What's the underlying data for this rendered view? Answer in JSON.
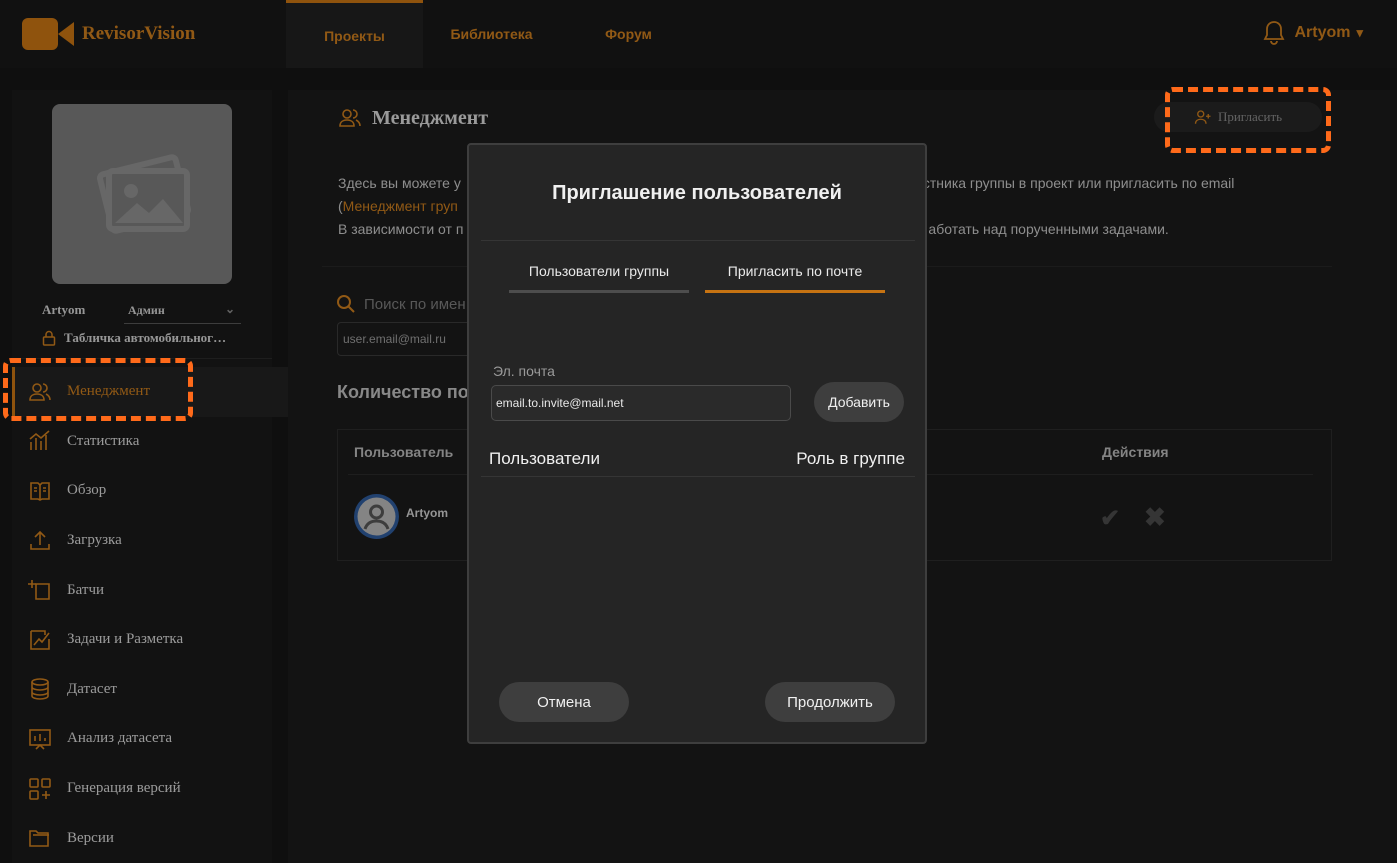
{
  "brand": {
    "name": "RevisorVision",
    "accent": "#c67312",
    "highlight": "#ff6a1a"
  },
  "nav": {
    "tabs": [
      {
        "label": "Проекты"
      },
      {
        "label": "Библиотека"
      },
      {
        "label": "Форум"
      }
    ]
  },
  "header": {
    "username": "Artyom",
    "caret": "▾"
  },
  "sidebar": {
    "user": "Artyom",
    "role": "Админ",
    "role_caret": "⌄",
    "project": "Табличка автомобильног…",
    "items": [
      {
        "label": "Менеджмент",
        "icon": "users-icon"
      },
      {
        "label": "Статистика",
        "icon": "stats-icon"
      },
      {
        "label": "Обзор",
        "icon": "book-icon"
      },
      {
        "label": "Загрузка",
        "icon": "upload-icon"
      },
      {
        "label": "Батчи",
        "icon": "batch-icon"
      },
      {
        "label": "Задачи и Разметка",
        "icon": "annotate-icon"
      },
      {
        "label": "Датасет",
        "icon": "database-icon"
      },
      {
        "label": "Анализ датасета",
        "icon": "analysis-icon"
      },
      {
        "label": "Генерация версий",
        "icon": "grid-plus-icon"
      },
      {
        "label": "Версии",
        "icon": "folders-icon"
      }
    ]
  },
  "main": {
    "title": "Менеджмент",
    "invite_label": "Пригласить",
    "desc_line1_start": "Здесь вы можете у",
    "desc_line1_end": "стника группы в проект или пригласить по email",
    "desc_line2_paren": "(",
    "desc_line2_link": "Менеджмент груп",
    "desc_line3_start": "В зависимости от п",
    "desc_line3_end": "аботать над порученными задачами.",
    "search_placeholder": "Поиск по имен",
    "email_placeholder": "user.email@mail.ru",
    "count_title": "Количество по",
    "table": {
      "col_user": "Пользователь",
      "col_actions": "Действия",
      "rows": [
        {
          "name": "Artyom",
          "accept": "✔",
          "reject": "✖"
        }
      ]
    }
  },
  "modal": {
    "title": "Приглашение пользователей",
    "tabs": [
      {
        "label": "Пользователи группы"
      },
      {
        "label": "Пригласить по почте"
      }
    ],
    "email_label": "Эл. почта",
    "email_value": "email.to.invite@mail.net",
    "add_label": "Добавить",
    "col_users": "Пользователи",
    "col_role": "Роль в группе",
    "cancel_label": "Отмена",
    "continue_label": "Продолжить"
  }
}
